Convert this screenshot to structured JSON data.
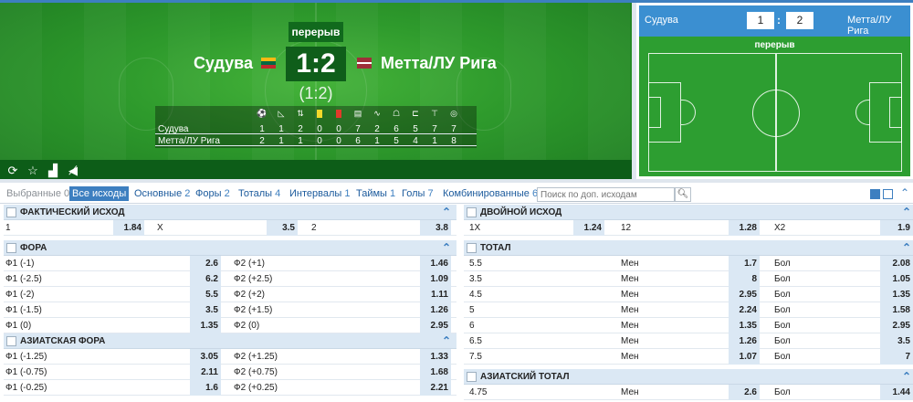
{
  "match": {
    "period": "перерыв",
    "home": "Судува",
    "away": "Метта/ЛУ Рига",
    "score": "1:2",
    "ht_score": "(1:2)",
    "stats_icons": [
      "ball-icon",
      "corner-icon",
      "substitution-icon",
      "yellow-card-icon",
      "red-card-icon",
      "shot-icon",
      "attack-icon",
      "kick-icon",
      "goal-kick-icon",
      "free-kick-icon",
      "possession-icon"
    ],
    "stats": [
      {
        "team": "Судува",
        "values": [
          "1",
          "1",
          "2",
          "0",
          "0",
          "7",
          "2",
          "6",
          "5",
          "7",
          "7"
        ]
      },
      {
        "team": "Метта/ЛУ Рига",
        "values": [
          "2",
          "1",
          "1",
          "0",
          "0",
          "6",
          "1",
          "5",
          "4",
          "1",
          "8"
        ]
      }
    ]
  },
  "side_panel": {
    "home": "Судува",
    "home_score": "1",
    "away_score": "2",
    "away": "Метта/ЛУ Рига",
    "period": "перерыв"
  },
  "tabs": [
    {
      "label": "Выбранные",
      "count": "0",
      "state": "off"
    },
    {
      "label": "Все исходы",
      "count": "",
      "state": "on"
    },
    {
      "label": "Основные",
      "count": "2",
      "state": "normal"
    },
    {
      "label": "Форы",
      "count": "2",
      "state": "normal"
    },
    {
      "label": "Тоталы",
      "count": "4",
      "state": "normal"
    },
    {
      "label": "Интервалы",
      "count": "1",
      "state": "normal"
    },
    {
      "label": "Таймы",
      "count": "1",
      "state": "normal"
    },
    {
      "label": "Голы",
      "count": "7",
      "state": "normal"
    },
    {
      "label": "Комбинированные",
      "count": "6",
      "state": "normal"
    }
  ],
  "search": {
    "placeholder": "Поиск по доп. исходам"
  },
  "markets": {
    "result": {
      "title": "Фактический исход",
      "rows": [
        [
          "1",
          "1.84",
          "X",
          "3.5",
          "2",
          "3.8"
        ]
      ]
    },
    "handicap": {
      "title": "Фора",
      "rows": [
        [
          "Ф1 (-1)",
          "2.6",
          "Ф2 (+1)",
          "1.46"
        ],
        [
          "Ф1 (-2.5)",
          "6.2",
          "Ф2 (+2.5)",
          "1.09"
        ],
        [
          "Ф1 (-2)",
          "5.5",
          "Ф2 (+2)",
          "1.11"
        ],
        [
          "Ф1 (-1.5)",
          "3.5",
          "Ф2 (+1.5)",
          "1.26"
        ],
        [
          "Ф1 (0)",
          "1.35",
          "Ф2 (0)",
          "2.95"
        ]
      ]
    },
    "asian_handicap": {
      "title": "Азиатская фора",
      "rows": [
        [
          "Ф1 (-1.25)",
          "3.05",
          "Ф2 (+1.25)",
          "1.33"
        ],
        [
          "Ф1 (-0.75)",
          "2.11",
          "Ф2 (+0.75)",
          "1.68"
        ],
        [
          "Ф1 (-0.25)",
          "1.6",
          "Ф2 (+0.25)",
          "2.21"
        ]
      ]
    },
    "double_chance": {
      "title": "Двойной исход",
      "rows": [
        [
          "1X",
          "1.24",
          "12",
          "1.28",
          "X2",
          "1.9"
        ]
      ]
    },
    "total": {
      "title": "Тотал",
      "rows": [
        [
          "5.5",
          "Мен",
          "1.7",
          "Бол",
          "2.08"
        ],
        [
          "3.5",
          "Мен",
          "8",
          "Бол",
          "1.05"
        ],
        [
          "4.5",
          "Мен",
          "2.95",
          "Бол",
          "1.35"
        ],
        [
          "5",
          "Мен",
          "2.24",
          "Бол",
          "1.58"
        ],
        [
          "6",
          "Мен",
          "1.35",
          "Бол",
          "2.95"
        ],
        [
          "6.5",
          "Мен",
          "1.26",
          "Бол",
          "3.5"
        ],
        [
          "7.5",
          "Мен",
          "1.07",
          "Бол",
          "7"
        ]
      ]
    },
    "asian_total": {
      "title": "Азиатский тотал",
      "rows": [
        [
          "4.75",
          "Мен",
          "2.6",
          "Бол",
          "1.44"
        ]
      ]
    }
  }
}
